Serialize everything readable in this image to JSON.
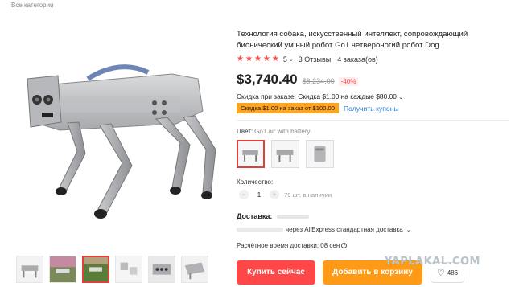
{
  "breadcrumb": {
    "label": "Все категории"
  },
  "product": {
    "title": "Технология собака, искусственный интеллект, сопровождающий бионический ум ный робот Go1 четвероногий робот Dog",
    "rating_value": "5",
    "reviews": "3 Отзывы",
    "orders": "4 заказа(ов)",
    "price": "$3,740.40",
    "old_price": "$6,234.00",
    "discount": "-40%",
    "coupon_line": "Скидка при заказе: Скидка $1.00 на каждые $80.00",
    "coupon_badge": "Скидка $1.00 на заказ от $100.00",
    "coupon_link": "Получить купоны"
  },
  "options": {
    "color_label": "Цвет:",
    "color_value": "Go1 air with battery",
    "swatches": [
      "robot-dog-air",
      "robot-dog-edu",
      "battery-pack"
    ]
  },
  "quantity": {
    "label": "Количество:",
    "minus": "−",
    "value": "1",
    "plus": "+",
    "stock": "79 шт. в наличии"
  },
  "delivery": {
    "label": "Доставка:",
    "method": "через AliExpress стандартная доставка",
    "eta": "Расчётное время доставки: 08 сен"
  },
  "actions": {
    "buy_now": "Купить сейчас",
    "add_to_cart": "Добавить в корзину",
    "wishlist_count": "486"
  },
  "watermark": "YAPLAKAL.COM",
  "colors": {
    "accent_red": "#ff4747",
    "accent_orange": "#ff9a16",
    "link_blue": "#2a7bd6",
    "coupon_yellow": "#ffa41f"
  }
}
